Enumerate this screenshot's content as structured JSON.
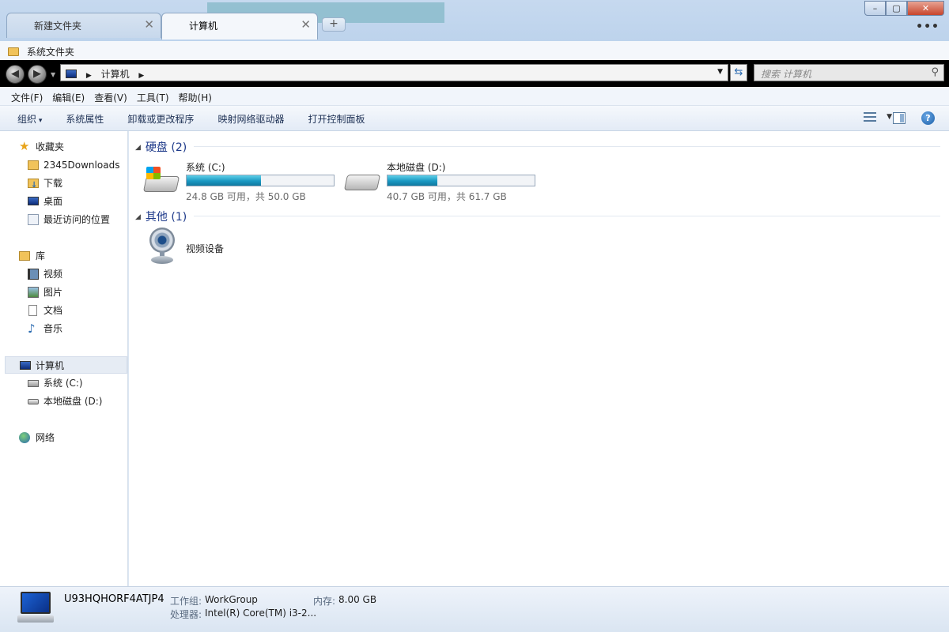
{
  "tabs": [
    {
      "label": "新建文件夹"
    },
    {
      "label": "计算机"
    }
  ],
  "window_controls": {
    "minimize": "▭",
    "maximize": "□",
    "close": "✕",
    "more": "•••"
  },
  "folder_tab": {
    "label": "系统文件夹"
  },
  "address": {
    "path": [
      "计算机"
    ],
    "search_placeholder": "搜索 计算机"
  },
  "menu": [
    "文件(F)",
    "编辑(E)",
    "查看(V)",
    "工具(T)",
    "帮助(H)"
  ],
  "commands": [
    "组织",
    "系统属性",
    "卸载或更改程序",
    "映射网络驱动器",
    "打开控制面板"
  ],
  "nav": {
    "favorites": {
      "label": "收藏夹",
      "items": [
        "2345Downloads",
        "下载",
        "桌面",
        "最近访问的位置"
      ]
    },
    "libraries": {
      "label": "库",
      "items": [
        "视频",
        "图片",
        "文档",
        "音乐"
      ]
    },
    "computer": {
      "label": "计算机",
      "items": [
        "系统 (C:)",
        "本地磁盘 (D:)"
      ]
    },
    "network": {
      "label": "网络"
    }
  },
  "groups": {
    "hdd": {
      "title": "硬盘",
      "count": "(2)"
    },
    "other": {
      "title": "其他",
      "count": "(1)"
    }
  },
  "drives": [
    {
      "name": "系统 (C:)",
      "free_text": "24.8 GB 可用，共 50.0 GB",
      "used_fraction": 0.504
    },
    {
      "name": "本地磁盘 (D:)",
      "free_text": "40.7 GB 可用，共 61.7 GB",
      "used_fraction": 0.34
    }
  ],
  "devices": [
    {
      "name": "视频设备"
    }
  ],
  "details": {
    "computer_name": "U93HQHORF4ATJP4",
    "workgroup_label": "工作组:",
    "workgroup_value": "WorkGroup",
    "memory_label": "内存:",
    "memory_value": "8.00 GB",
    "cpu_label": "处理器:",
    "cpu_value": "Intel(R) Core(TM) i3-2..."
  }
}
